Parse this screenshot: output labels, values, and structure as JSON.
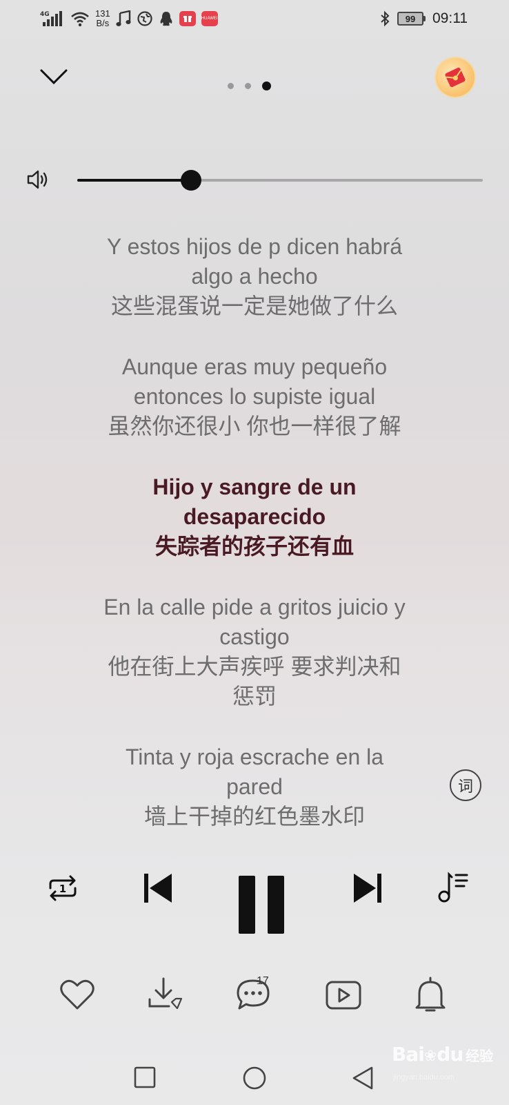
{
  "status_bar": {
    "network": "4G",
    "net_speed_value": "131",
    "net_speed_unit": "B/s",
    "battery": "99",
    "time": "09:11",
    "app_icon_text": "HUAWEI"
  },
  "header": {
    "pager": {
      "count": 3,
      "active_index": 2
    }
  },
  "volume": {
    "level": 0.28
  },
  "lyrics": {
    "stanzas": [
      {
        "lines": [
          "Y estos hijos de p dicen habrá",
          "algo a hecho",
          "这些混蛋说一定是她做了什么"
        ],
        "current": false
      },
      {
        "lines": [
          "Aunque eras muy pequeño",
          "entonces lo supiste igual",
          "虽然你还很小 你也一样很了解"
        ],
        "current": false
      },
      {
        "lines": [
          "Hijo y sangre de un",
          "desaparecido",
          "失踪者的孩子还有血"
        ],
        "current": true
      },
      {
        "lines": [
          "En la calle pide a gritos juicio y",
          "castigo",
          "他在街上大声疾呼 要求判决和",
          "惩罚"
        ],
        "current": false
      },
      {
        "lines": [
          "Tinta y roja escrache en la",
          "pared",
          "墙上干掉的红色墨水印"
        ],
        "current": false
      }
    ],
    "toggle_label": "词"
  },
  "player": {
    "repeat_mode": "1",
    "comment_count": "17"
  },
  "watermark": {
    "brand": "Bai",
    "brand2": "du",
    "suffix": "经验",
    "url": "jingyan.baidu.com"
  },
  "colors": {
    "current_lyric": "#4a1a24",
    "lyric": "#6d6d6d",
    "accent": "#111111"
  }
}
